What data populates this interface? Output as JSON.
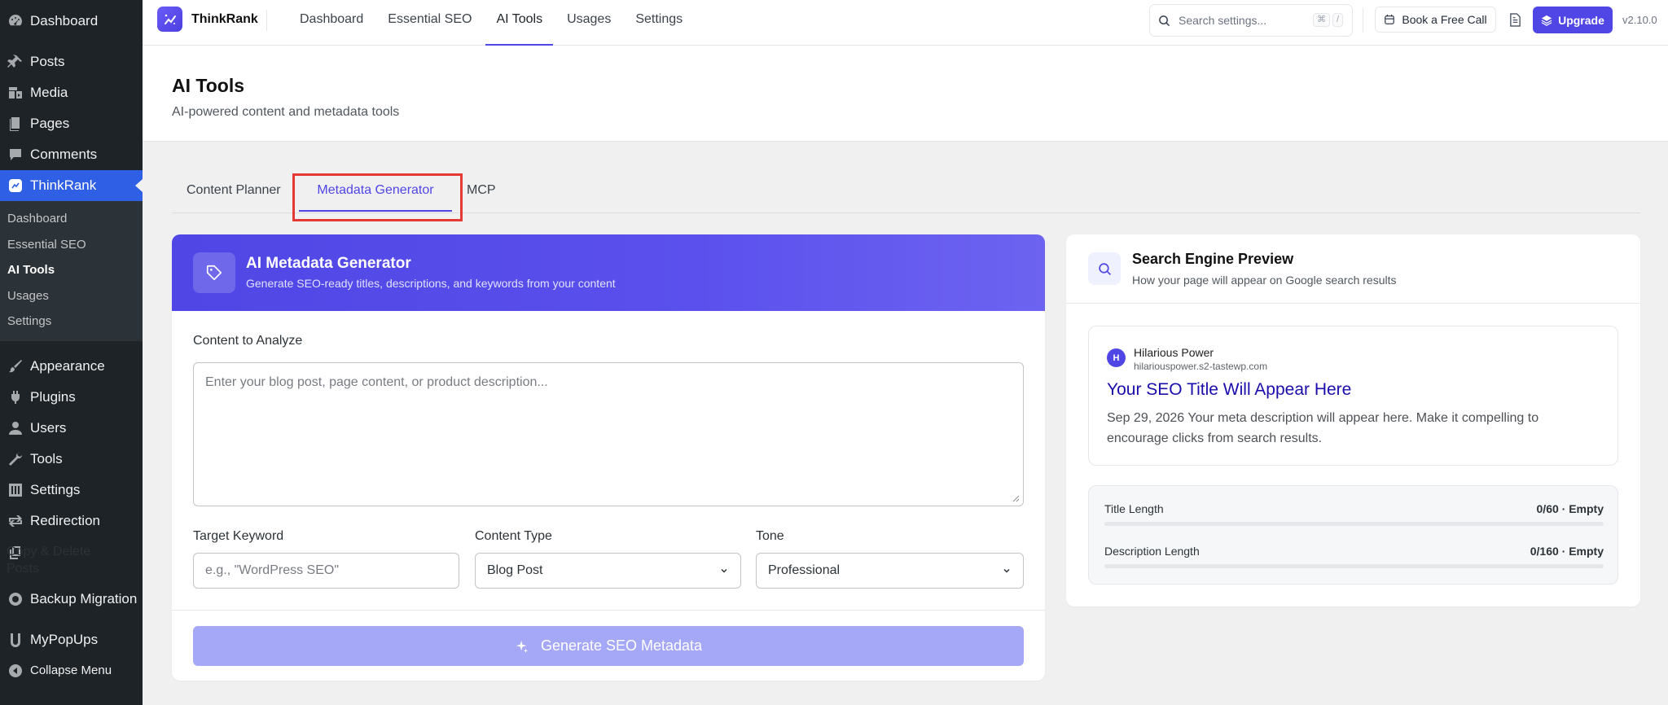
{
  "wp_menu": {
    "dashboard": "Dashboard",
    "posts": "Posts",
    "media": "Media",
    "pages": "Pages",
    "comments": "Comments",
    "thinkrank": "ThinkRank",
    "sub": [
      "Dashboard",
      "Essential SEO",
      "AI Tools",
      "Usages",
      "Settings"
    ],
    "appearance": "Appearance",
    "plugins": "Plugins",
    "users": "Users",
    "tools": "Tools",
    "settings": "Settings",
    "redirection": "Redirection",
    "copy_delete_1": "Copy & Delete",
    "copy_delete_2": "Posts",
    "backup": "Backup Migration",
    "mypopups": "MyPopUps",
    "collapse": "Collapse Menu"
  },
  "header": {
    "brand": "ThinkRank",
    "nav": [
      "Dashboard",
      "Essential SEO",
      "AI Tools",
      "Usages",
      "Settings"
    ],
    "search_placeholder": "Search settings...",
    "kbd_cmd": "⌘",
    "kbd_slash": "/",
    "call_label": "Book a Free Call",
    "upgrade_label": "Upgrade",
    "version": "v2.10.0"
  },
  "page": {
    "title": "AI Tools",
    "subtitle": "AI-powered content and metadata tools"
  },
  "tabs": [
    "Content Planner",
    "Metadata Generator",
    "MCP"
  ],
  "generator": {
    "title": "AI Metadata Generator",
    "subtitle": "Generate SEO-ready titles, descriptions, and keywords from your content",
    "content_label": "Content to Analyze",
    "content_placeholder": "Enter your blog post, page content, or product description...",
    "keyword_label": "Target Keyword",
    "keyword_placeholder": "e.g., \"WordPress SEO\"",
    "type_label": "Content Type",
    "type_value": "Blog Post",
    "tone_label": "Tone",
    "tone_value": "Professional",
    "button": "Generate SEO Metadata"
  },
  "preview": {
    "title": "Search Engine Preview",
    "subtitle": "How your page will appear on Google search results",
    "favicon_letter": "H",
    "site_name": "Hilarious Power",
    "site_url": "hilariouspower.s2-tastewp.com",
    "result_title": "Your SEO Title Will Appear Here",
    "result_desc": "Sep 29, 2026 Your meta description will appear here. Make it compelling to encourage clicks from search results.",
    "title_length_label": "Title Length",
    "title_length_value": "0/60 · Empty",
    "desc_length_label": "Description Length",
    "desc_length_value": "0/160 · Empty"
  },
  "colors": {
    "accent": "#4f46e5",
    "wp_dark": "#1d2327",
    "wp_active": "#2f5fe4",
    "link": "#1a0dab"
  }
}
